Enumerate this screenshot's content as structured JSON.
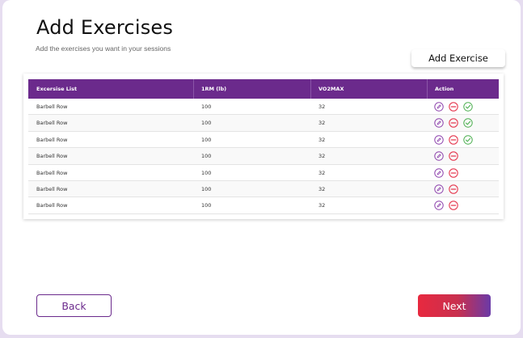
{
  "page": {
    "title": "Add Exercises",
    "subtitle": "Add the exercises you want in your sessions"
  },
  "toolbar": {
    "add_exercise_label": "Add Exercise"
  },
  "table": {
    "headers": [
      "Excersise List",
      "1RM (lb)",
      "VO2MAX",
      "Action"
    ],
    "rows": [
      {
        "exercise": "Barbell Row",
        "one_rm": "100",
        "vo2max": "32",
        "actions": [
          "edit-icon",
          "remove-icon",
          "check-icon"
        ]
      },
      {
        "exercise": "Barbell Row",
        "one_rm": "100",
        "vo2max": "32",
        "actions": [
          "edit-icon",
          "remove-icon",
          "check-icon"
        ]
      },
      {
        "exercise": "Barbell Row",
        "one_rm": "100",
        "vo2max": "32",
        "actions": [
          "edit-icon",
          "remove-icon",
          "check-icon"
        ]
      },
      {
        "exercise": "Barbell Row",
        "one_rm": "100",
        "vo2max": "32",
        "actions": [
          "edit-icon",
          "remove-icon"
        ]
      },
      {
        "exercise": "Barbell Row",
        "one_rm": "100",
        "vo2max": "32",
        "actions": [
          "edit-icon",
          "remove-icon"
        ]
      },
      {
        "exercise": "Barbell Row",
        "one_rm": "100",
        "vo2max": "32",
        "actions": [
          "edit-icon",
          "remove-icon"
        ]
      },
      {
        "exercise": "Barbell Row",
        "one_rm": "100",
        "vo2max": "32",
        "actions": [
          "edit-icon",
          "remove-icon"
        ]
      }
    ]
  },
  "footer": {
    "back_label": "Back",
    "next_label": "Next"
  },
  "colors": {
    "accent_purple": "#6b2a8c",
    "edit_icon": "#8e44ad",
    "remove_icon": "#e53950",
    "check_icon": "#4caf50",
    "next_gradient_start": "#e8293f",
    "next_gradient_end": "#6a3aa8"
  }
}
